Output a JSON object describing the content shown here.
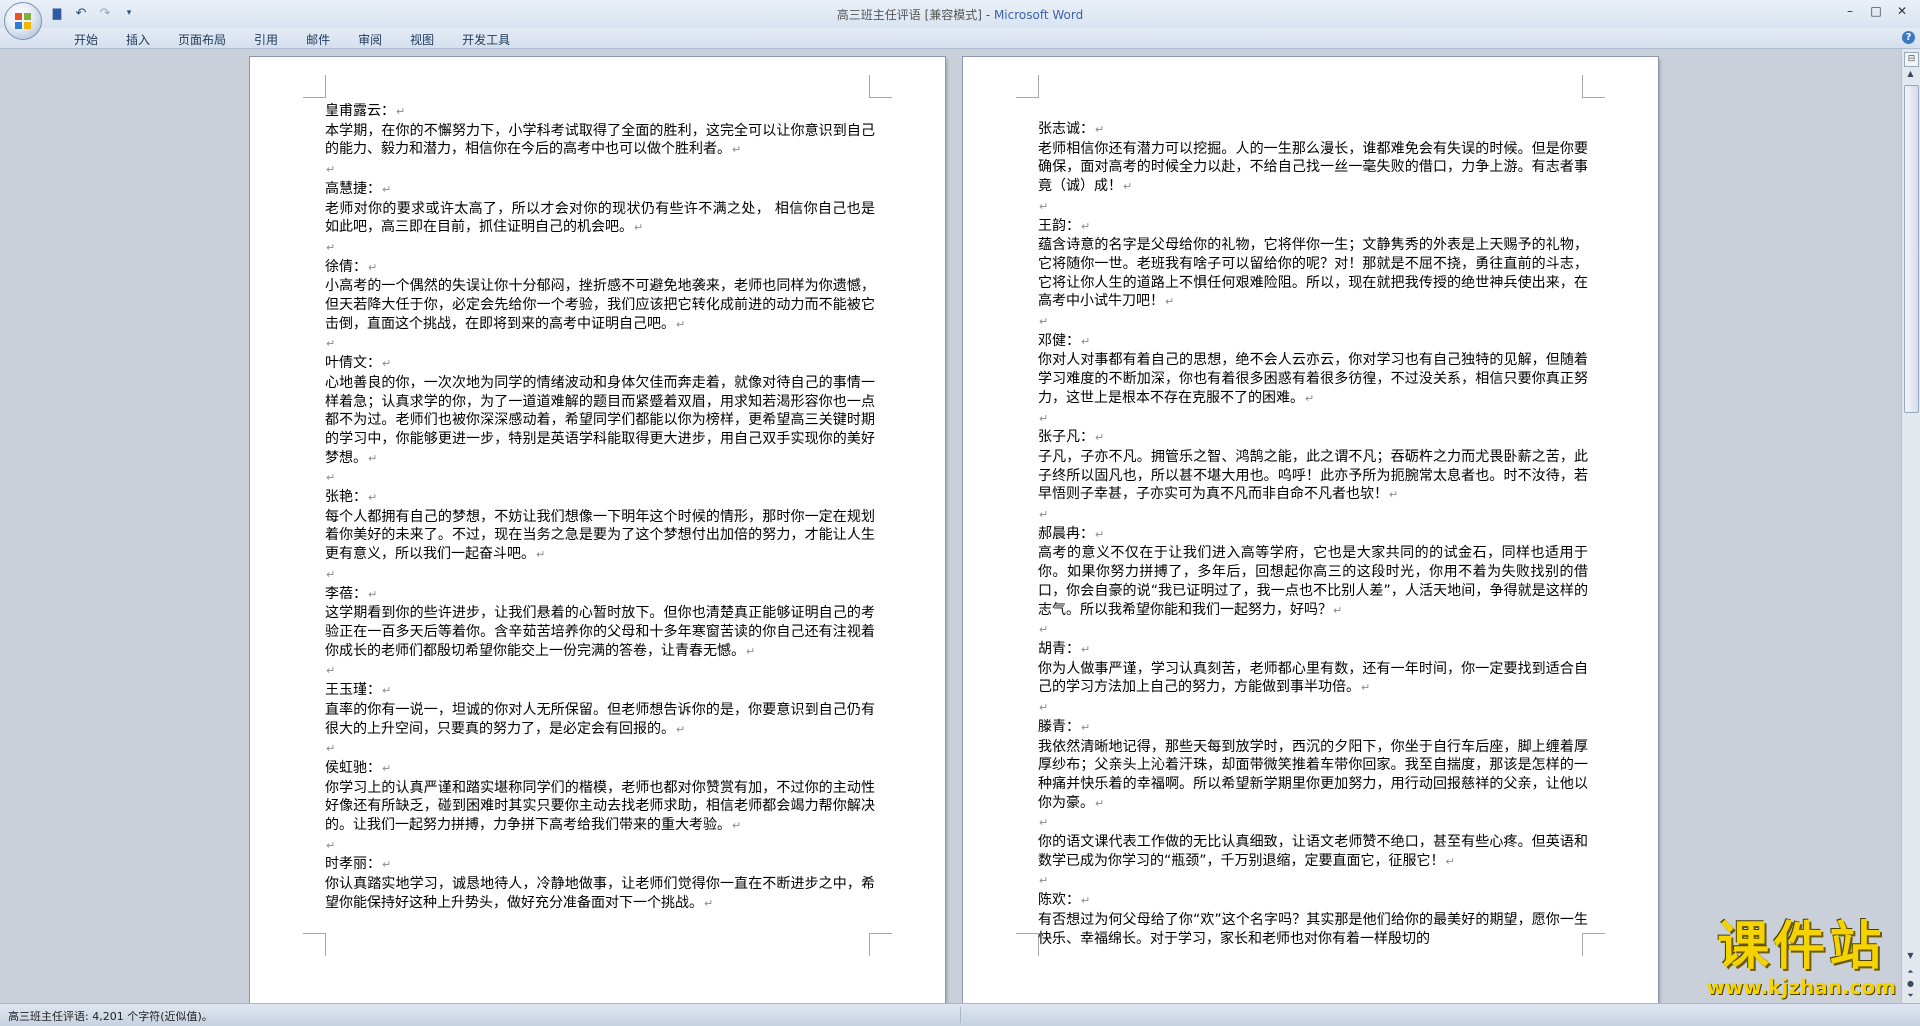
{
  "window": {
    "title_doc": "高三班主任评语 [兼容模式]",
    "title_sep": " - ",
    "title_app": "Microsoft Word",
    "controls": [
      "–",
      "□",
      "✕"
    ]
  },
  "qat": {
    "save_icon": "▇",
    "undo_icon": "↶",
    "redo_icon": "↷",
    "more_icon": "▾"
  },
  "menu": {
    "tabs": [
      "开始",
      "插入",
      "页面布局",
      "引用",
      "邮件",
      "审阅",
      "视图",
      "开发工具"
    ],
    "help": "?"
  },
  "pages": [
    {
      "entries": [
        {
          "name": "皇甫露云：",
          "text": "本学期，在你的不懈努力下，小学科考试取得了全面的胜利，这完全可以让你意识到自己的能力、毅力和潜力，相信你在今后的高考中也可以做个胜利者。"
        },
        {
          "name": "高慧捷：",
          "text": "老师对你的要求或许太高了，所以才会对你的现状仍有些许不满之处， 相信你自己也是如此吧，高三即在目前，抓住证明自己的机会吧。"
        },
        {
          "name": "徐倩：",
          "text": "小高考的一个偶然的失误让你十分郁闷，挫折感不可避免地袭来，老师也同样为你遗憾，但天若降大任于你，必定会先给你一个考验，我们应该把它转化成前进的动力而不能被它击倒，直面这个挑战，在即将到来的高考中证明自己吧。"
        },
        {
          "name": "叶倩文：",
          "text": "心地善良的你，一次次地为同学的情绪波动和身体欠佳而奔走着，就像对待自己的事情一样着急；认真求学的你，为了一道道难解的题目而紧蹙着双眉，用求知若渴形容你也一点都不为过。老师们也被你深深感动着，希望同学们都能以你为榜样，更希望高三关键时期的学习中，你能够更进一步，特别是英语学科能取得更大进步，用自己双手实现你的美好梦想。"
        },
        {
          "name": "张艳：",
          "text": "每个人都拥有自己的梦想，不妨让我们想像一下明年这个时候的情形，那时你一定在规划着你美好的未来了。不过，现在当务之急是要为了这个梦想付出加倍的努力，才能让人生更有意义，所以我们一起奋斗吧。"
        },
        {
          "name": "李蓓：",
          "text": "这学期看到你的些许进步，让我们悬着的心暂时放下。但你也清楚真正能够证明自己的考验正在一百多天后等着你。含辛茹苦培养你的父母和十多年寒窗苦读的你自己还有注视着你成长的老师们都殷切希望你能交上一份完满的答卷，让青春无憾。"
        },
        {
          "name": "王玉瑾：",
          "text": "直率的你有一说一，坦诚的你对人无所保留。但老师想告诉你的是，你要意识到自己仍有很大的上升空间，只要真的努力了，是必定会有回报的。"
        },
        {
          "name": "侯虹驰：",
          "text": "你学习上的认真严谨和踏实堪称同学们的楷模，老师也都对你赞赏有加，不过你的主动性好像还有所缺乏，碰到困难时其实只要你主动去找老师求助，相信老师都会竭力帮你解决的。让我们一起努力拼搏，力争拼下高考给我们带来的重大考验。"
        },
        {
          "name": "时孝丽：",
          "text": "你认真踏实地学习，诚恳地待人，冷静地做事，让老师们觉得你一直在不断进步之中，希望你能保持好这种上升势头，做好充分准备面对下一个挑战。"
        }
      ]
    },
    {
      "entries": [
        {
          "name": "张志诚：",
          "text": "老师相信你还有潜力可以挖掘。人的一生那么漫长，谁都难免会有失误的时候。但是你要确保，面对高考的时候全力以赴，不给自己找一丝一毫失败的借口，力争上游。有志者事竟（诚）成！"
        },
        {
          "name": "王韵：",
          "text": "蕴含诗意的名字是父母给你的礼物，它将伴你一生；文静隽秀的外表是上天赐予的礼物，它将随你一世。老班我有啥子可以留给你的呢？对！那就是不屈不挠，勇往直前的斗志，它将让你人生的道路上不惧任何艰难险阻。所以，现在就把我传授的绝世神兵使出来，在高考中小试牛刀吧！"
        },
        {
          "name": "邓健：",
          "text": "你对人对事都有着自己的思想，绝不会人云亦云，你对学习也有自己独特的见解，但随着学习难度的不断加深，你也有着很多困惑有着很多彷徨，不过没关系，相信只要你真正努力，这世上是根本不存在克服不了的困难。"
        },
        {
          "name": "张子凡：",
          "text": "子凡，子亦不凡。拥管乐之智、鸿鹄之能，此之谓不凡；吞砺杵之力而尤畏卧薪之苦，此子终所以固凡也，所以甚不堪大用也。呜呼！此亦予所为扼腕常太息者也。时不汝待，若早悟则子幸甚，子亦实可为真不凡而非自命不凡者也欤！"
        },
        {
          "name": "郝晨冉：",
          "text": "高考的意义不仅在于让我们进入高等学府，它也是大家共同的的试金石，同样也适用于你。如果你努力拼搏了，多年后，回想起你高三的这段时光，你用不着为失败找别的借口，你会自豪的说“我已证明过了，我一点也不比别人差”，人活天地间，争得就是这样的志气。所以我希望你能和我们一起努力，好吗？"
        },
        {
          "name": "胡青：",
          "text": "你为人做事严谨，学习认真刻苦，老师都心里有数，还有一年时间，你一定要找到适合自己的学习方法加上自己的努力，方能做到事半功倍。"
        },
        {
          "name": "滕青：",
          "text": "我依然清晰地记得，那些天每到放学时，西沉的夕阳下，你坐于自行车后座，脚上缠着厚厚纱布；父亲头上沁着汗珠，却面带微笑推着车带你回家。我至自揣度，那该是怎样的一种痛并快乐着的幸福啊。所以希望新学期里你更加努力，用行动回报慈祥的父亲，让他以你为豪。"
        },
        {
          "name": "",
          "text": "你的语文课代表工作做的无比认真细致，让语文老师赞不绝口，甚至有些心疼。但英语和数学已成为你学习的“瓶颈”，千万别退缩，定要直面它，征服它！"
        },
        {
          "name": "陈欢：",
          "text": "有否想过为何父母给了你“欢”这个名字吗？其实那是他们给你的最美好的期望，愿你一生快乐、幸福绵长。对于学习，家长和老师也对你有着一样殷切的"
        }
      ]
    }
  ],
  "status": {
    "text": "高三班主任评语: 4,201 个字符(近似值)。"
  },
  "watermark": {
    "title": "课件站",
    "url": "www.kjzhan.com"
  }
}
